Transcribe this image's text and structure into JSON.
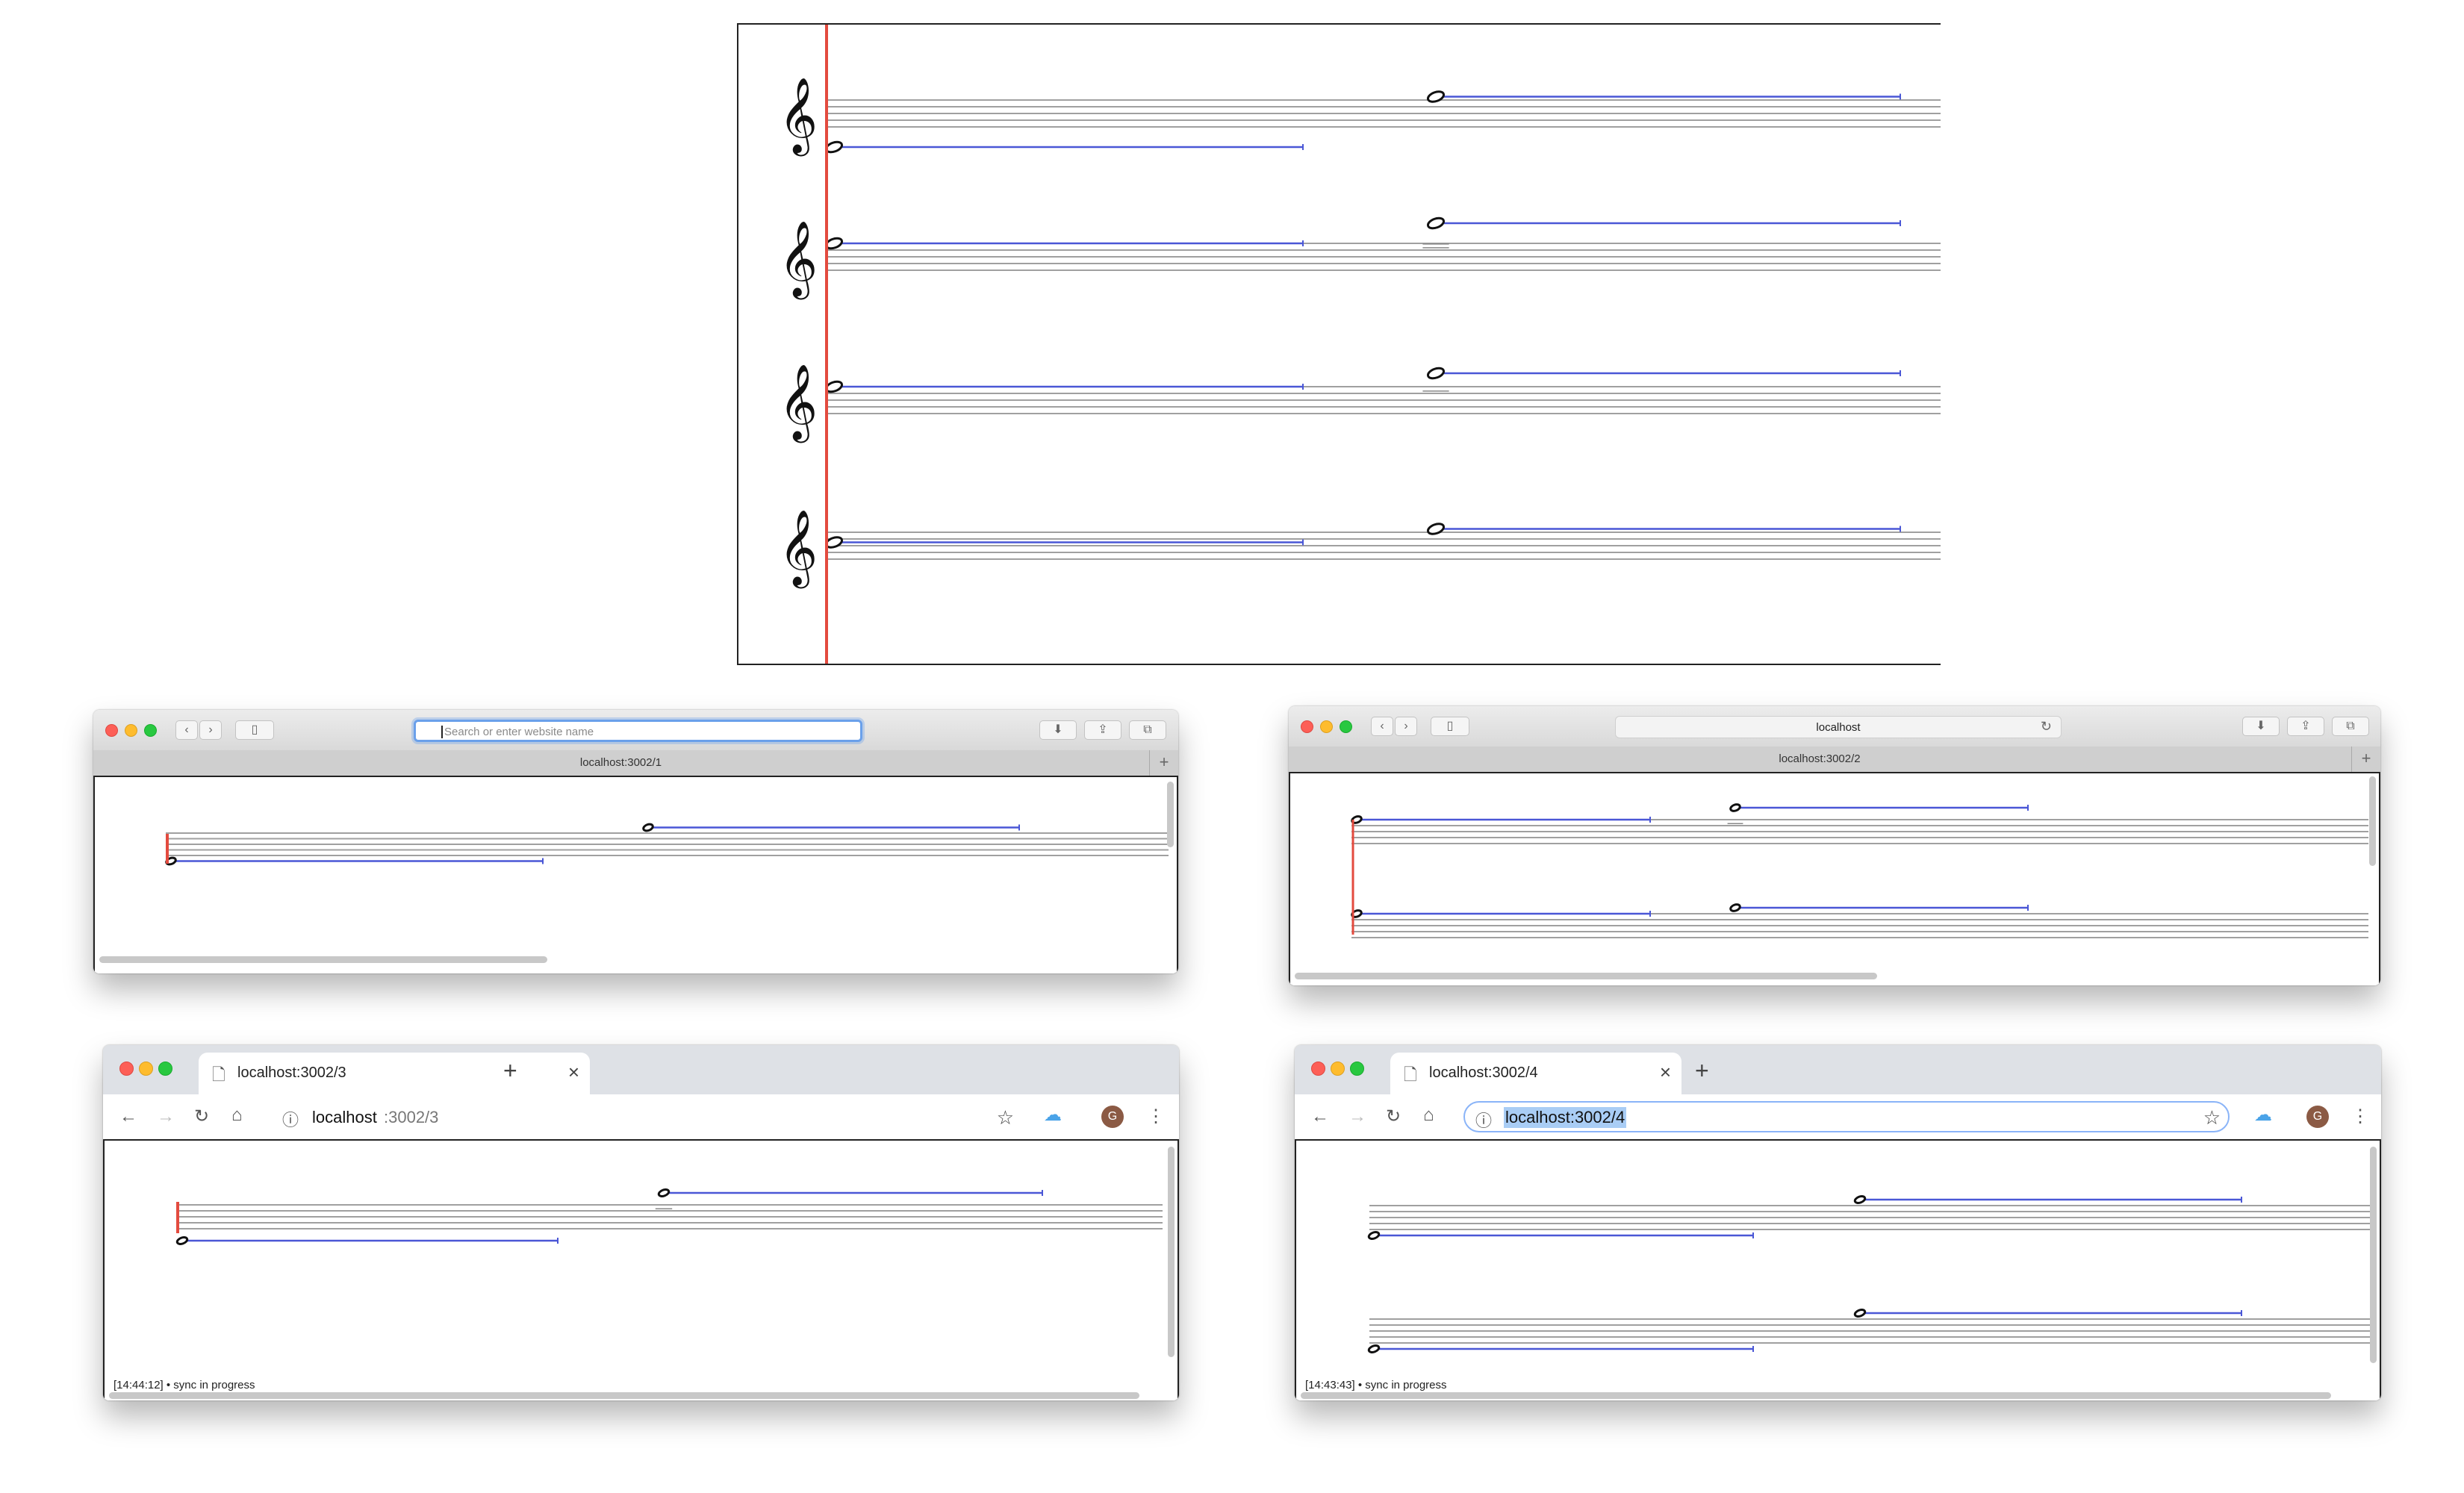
{
  "top_panel": {
    "staves": 4,
    "clef": "treble-clef"
  },
  "windows": [
    {
      "browser": "safari",
      "address_placeholder": "Search or enter website name",
      "address_value": "",
      "tab_title": "localhost:3002/1"
    },
    {
      "browser": "safari",
      "address_value": "localhost",
      "tab_title": "localhost:3002/2"
    },
    {
      "browser": "chrome",
      "tab_title": "localhost:3002/3",
      "url_host": "localhost",
      "url_rest": ":3002/3",
      "avatar_letter": "G",
      "status_text": "[14:44:12] • sync in progress"
    },
    {
      "browser": "chrome",
      "tab_title": "localhost:3002/4",
      "url_selected": "localhost:3002/4",
      "avatar_letter": "G",
      "status_text": "[14:43:43] • sync in progress"
    }
  ],
  "icons": {
    "new_tab": "+",
    "close_tab": "×",
    "back": "←",
    "forward": "→",
    "reload": "↻",
    "home": "⌂",
    "star": "☆",
    "menu": "⋮",
    "info": "ⓘ",
    "cloud": "☁",
    "page": "🗋",
    "safari_back": "‹",
    "safari_forward": "›",
    "download": "⬇",
    "share": "⇪",
    "tabs": "⧉",
    "sidebar": "▯",
    "safari_reload": "↻",
    "clef": "𝄞"
  },
  "colors": {
    "playhead": "#e34b3f",
    "note_bar": "#4a57d6",
    "staff_line": "#a0a0a0",
    "selection": "#a9cdf5"
  }
}
